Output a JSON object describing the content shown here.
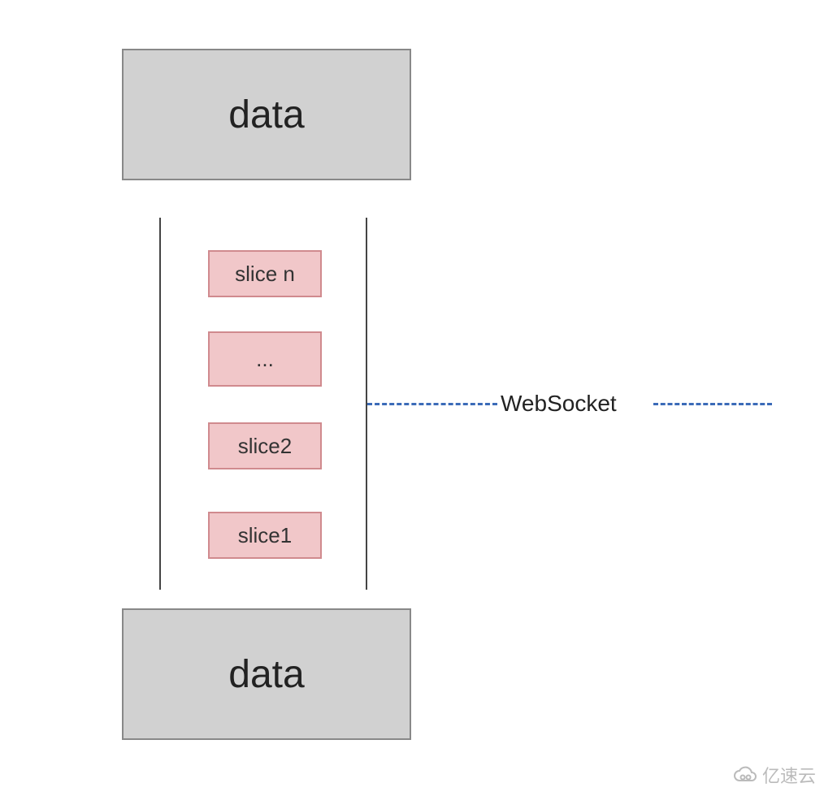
{
  "topBox": {
    "label": "data"
  },
  "bottomBox": {
    "label": "data"
  },
  "channel": {
    "slices": [
      {
        "label": "slice n"
      },
      {
        "label": "..."
      },
      {
        "label": "slice2"
      },
      {
        "label": "slice1"
      }
    ]
  },
  "connection": {
    "label": "WebSocket"
  },
  "watermark": {
    "text": "亿速云"
  }
}
